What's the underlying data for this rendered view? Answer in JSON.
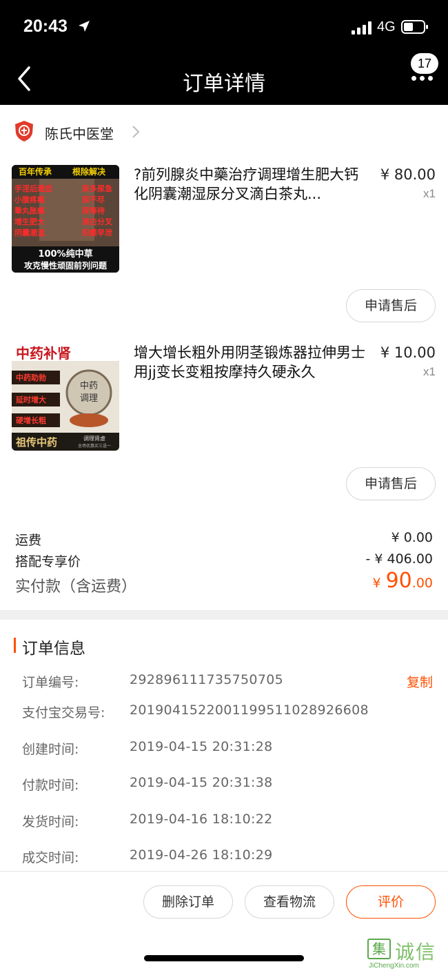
{
  "status_bar": {
    "time": "20:43",
    "network": "4G"
  },
  "nav": {
    "title": "订单详情",
    "badge_count": "17"
  },
  "shop": {
    "name": "陈氏中医堂"
  },
  "products": [
    {
      "title": "?前列腺炎中藥治疗调理增生肥大钙化阴囊潮湿尿分叉滴白茶丸...",
      "price": "¥ 80.00",
      "qty": "x1",
      "after_sale": "申请售后",
      "thumb": {
        "top_left": "百年传承",
        "top_right": "根除解决",
        "left_lines": [
          "手淫后遗症",
          "小腹疼痛",
          "睾丸胀痛",
          "增生肥大",
          "阴囊潮湿"
        ],
        "right_lines": [
          "尿多尿急",
          "尿不尽",
          "尿等待",
          "滴白分叉",
          "阳萎早泄"
        ],
        "bottom_1": "100%纯中草",
        "bottom_2": "攻克慢性顽固前列问题"
      }
    },
    {
      "title": "增大增长粗外用阴茎锻炼器拉伸男士用jj变长变粗按摩持久硬永久",
      "price": "¥ 10.00",
      "qty": "x1",
      "after_sale": "申请售后",
      "thumb": {
        "banner": "中药补肾",
        "tags": [
          "中药助勃",
          "延时增大",
          "硬增长粗"
        ],
        "circle_top": "中药",
        "circle_bottom": "调理",
        "bottom_left": "祖传中药",
        "bottom_right_1": "调理肾虚",
        "bottom_right_2": "全场优惠买三送一"
      }
    }
  ],
  "summary": {
    "shipping_label": "运费",
    "shipping_value": "¥ 0.00",
    "bundle_label": "搭配专享价",
    "bundle_value": "- ¥ 406.00",
    "total_label": "实付款（含运费）",
    "total_currency": "¥",
    "total_int": "90",
    "total_dec": ".00"
  },
  "order_info": {
    "title": "订单信息",
    "copy_label": "复制",
    "rows": [
      {
        "label": "订单编号:",
        "value": "292896111735750705"
      },
      {
        "label": "支付宝交易号:",
        "value": "2019041522001199511028926608"
      },
      {
        "label": "创建时间:",
        "value": "2019-04-15 20:31:28"
      },
      {
        "label": "付款时间:",
        "value": "2019-04-15 20:31:38"
      },
      {
        "label": "发货时间:",
        "value": "2019-04-16 18:10:22"
      },
      {
        "label": "成交时间:",
        "value": "2019-04-26 18:10:29"
      }
    ]
  },
  "actions": {
    "delete": "删除订单",
    "logistics": "查看物流",
    "review": "评价"
  },
  "watermark": {
    "box_char": "集",
    "text": "诚信",
    "url": "JiChengXin.com"
  },
  "colors": {
    "accent": "#ff5000",
    "topbar": "#000000"
  }
}
